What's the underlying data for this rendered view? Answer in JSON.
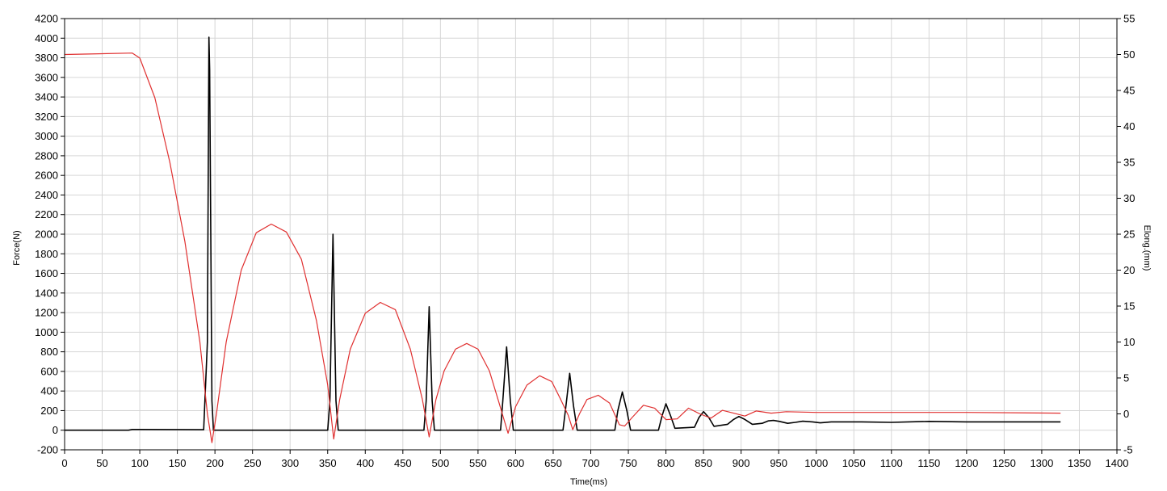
{
  "chart_data": {
    "type": "line",
    "title": "",
    "xlabel": "Time(ms)",
    "ylabel": "Force(N)",
    "y2label": "Elong.(mm)",
    "xlim": [
      0,
      1400
    ],
    "ylim": [
      -200,
      4200
    ],
    "y2lim": [
      -5,
      55
    ],
    "x_ticks": [
      0,
      50,
      100,
      150,
      200,
      250,
      300,
      350,
      400,
      450,
      500,
      550,
      600,
      650,
      700,
      750,
      800,
      850,
      900,
      950,
      1000,
      1050,
      1100,
      1150,
      1200,
      1250,
      1300,
      1350,
      1400
    ],
    "y_ticks": [
      -200,
      0,
      200,
      400,
      600,
      800,
      1000,
      1200,
      1400,
      1600,
      1800,
      2000,
      2200,
      2400,
      2600,
      2800,
      3000,
      3200,
      3400,
      3600,
      3800,
      4000,
      4200
    ],
    "y2_ticks": [
      -5,
      0,
      5,
      10,
      15,
      20,
      25,
      30,
      35,
      40,
      45,
      50,
      55
    ],
    "grid": true,
    "colors": {
      "force": "#000000",
      "elong": "#e03030",
      "grid": "#d6d6d6",
      "axis": "#000000"
    },
    "series": [
      {
        "axis": "left",
        "color": "#000000",
        "points": [
          [
            0,
            0
          ],
          [
            85,
            0
          ],
          [
            90,
            8
          ],
          [
            100,
            8
          ],
          [
            185,
            5
          ],
          [
            190,
            900
          ],
          [
            192,
            4010
          ],
          [
            193,
            3680
          ],
          [
            196,
            300
          ],
          [
            198,
            0
          ],
          [
            350,
            0
          ],
          [
            353,
            300
          ],
          [
            357,
            2000
          ],
          [
            361,
            300
          ],
          [
            364,
            0
          ],
          [
            478,
            0
          ],
          [
            481,
            300
          ],
          [
            485,
            1260
          ],
          [
            489,
            300
          ],
          [
            492,
            0
          ],
          [
            580,
            0
          ],
          [
            583,
            300
          ],
          [
            588,
            850
          ],
          [
            593,
            300
          ],
          [
            597,
            0
          ],
          [
            663,
            0
          ],
          [
            667,
            250
          ],
          [
            672,
            580
          ],
          [
            677,
            250
          ],
          [
            682,
            0
          ],
          [
            732,
            0
          ],
          [
            736,
            200
          ],
          [
            742,
            390
          ],
          [
            748,
            200
          ],
          [
            753,
            0
          ],
          [
            790,
            0
          ],
          [
            795,
            150
          ],
          [
            800,
            270
          ],
          [
            806,
            150
          ],
          [
            812,
            20
          ],
          [
            838,
            30
          ],
          [
            844,
            130
          ],
          [
            850,
            190
          ],
          [
            857,
            130
          ],
          [
            864,
            40
          ],
          [
            882,
            60
          ],
          [
            890,
            110
          ],
          [
            897,
            140
          ],
          [
            905,
            110
          ],
          [
            915,
            60
          ],
          [
            928,
            70
          ],
          [
            936,
            95
          ],
          [
            943,
            100
          ],
          [
            951,
            90
          ],
          [
            962,
            70
          ],
          [
            972,
            80
          ],
          [
            982,
            92
          ],
          [
            995,
            85
          ],
          [
            1005,
            75
          ],
          [
            1020,
            85
          ],
          [
            1060,
            85
          ],
          [
            1100,
            80
          ],
          [
            1150,
            90
          ],
          [
            1200,
            85
          ],
          [
            1250,
            85
          ],
          [
            1300,
            85
          ],
          [
            1325,
            85
          ]
        ]
      },
      {
        "axis": "right",
        "color": "#e03030",
        "points": [
          [
            0,
            50
          ],
          [
            90,
            50.2
          ],
          [
            100,
            49.5
          ],
          [
            120,
            44
          ],
          [
            140,
            35
          ],
          [
            160,
            24
          ],
          [
            180,
            10
          ],
          [
            190,
            0
          ],
          [
            196,
            -4
          ],
          [
            202,
            0
          ],
          [
            215,
            10
          ],
          [
            235,
            20
          ],
          [
            255,
            25.2
          ],
          [
            275,
            26.4
          ],
          [
            295,
            25.3
          ],
          [
            315,
            21.5
          ],
          [
            335,
            13
          ],
          [
            350,
            4
          ],
          [
            358,
            -3.5
          ],
          [
            366,
            2
          ],
          [
            380,
            9
          ],
          [
            400,
            14
          ],
          [
            420,
            15.5
          ],
          [
            440,
            14.5
          ],
          [
            460,
            9
          ],
          [
            476,
            2
          ],
          [
            485,
            -3.2
          ],
          [
            494,
            2
          ],
          [
            505,
            6
          ],
          [
            520,
            9
          ],
          [
            535,
            9.8
          ],
          [
            550,
            9
          ],
          [
            565,
            6
          ],
          [
            578,
            1.5
          ],
          [
            590,
            -2.7
          ],
          [
            600,
            1
          ],
          [
            615,
            4
          ],
          [
            632,
            5.3
          ],
          [
            648,
            4.5
          ],
          [
            660,
            2
          ],
          [
            670,
            -0.2
          ],
          [
            676,
            -2.2
          ],
          [
            685,
            0
          ],
          [
            695,
            2
          ],
          [
            710,
            2.6
          ],
          [
            725,
            1.5
          ],
          [
            738,
            -1.5
          ],
          [
            745,
            -1.7
          ],
          [
            755,
            -0.5
          ],
          [
            770,
            1.2
          ],
          [
            785,
            0.8
          ],
          [
            800,
            -0.8
          ],
          [
            815,
            -0.7
          ],
          [
            830,
            0.8
          ],
          [
            845,
            0
          ],
          [
            860,
            -0.6
          ],
          [
            875,
            0.5
          ],
          [
            890,
            0.1
          ],
          [
            905,
            -0.3
          ],
          [
            920,
            0.4
          ],
          [
            940,
            0.1
          ],
          [
            960,
            0.3
          ],
          [
            1000,
            0.2
          ],
          [
            1100,
            0.2
          ],
          [
            1200,
            0.2
          ],
          [
            1325,
            0.1
          ]
        ]
      }
    ]
  }
}
